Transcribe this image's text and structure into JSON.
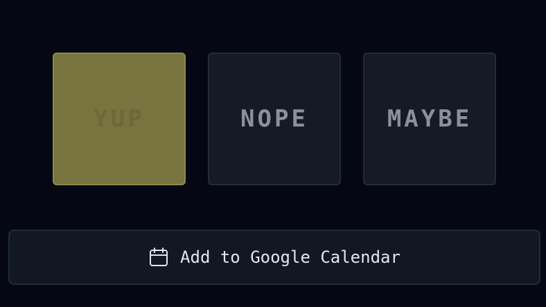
{
  "rsvp": {
    "options": [
      {
        "label": "YUP",
        "selected": true
      },
      {
        "label": "NOPE",
        "selected": false
      },
      {
        "label": "MAYBE",
        "selected": false
      }
    ]
  },
  "calendar_button": {
    "label": "Add to Google Calendar",
    "icon": "calendar-icon"
  },
  "colors": {
    "background": "#050812",
    "selected": "#78743f",
    "card": "#151a26"
  }
}
